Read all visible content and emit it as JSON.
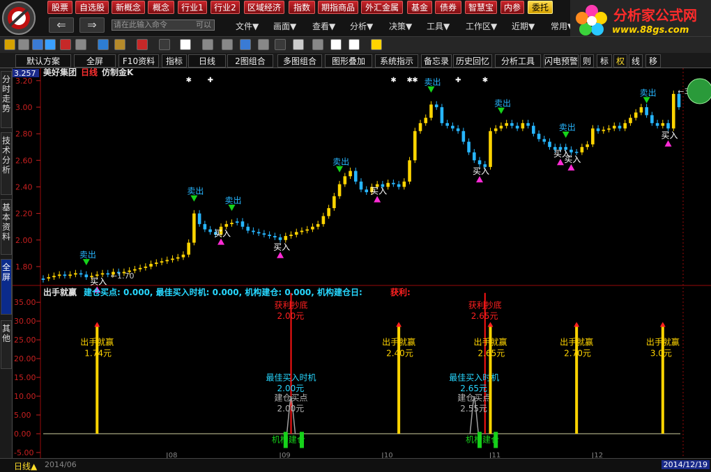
{
  "menu_buttons": [
    "股票",
    "自选股",
    "新概念",
    "概念",
    "行业1",
    "行业2",
    "区域经济",
    "指数",
    "期指商品",
    "外汇金属",
    "基金",
    "债券",
    "智慧宝",
    "内参",
    "委托"
  ],
  "command_input": {
    "placeholder": "请在此输入命令",
    "hint": "可以"
  },
  "nav": {
    "back": "⇐",
    "forward": "⇒"
  },
  "top_menus": [
    "文件▼",
    "画面▼",
    "查看▼",
    "分析▼",
    "决策▼",
    "工具▼",
    "工作区▼",
    "近期▼",
    "常用▼"
  ],
  "brand": {
    "title": "分析家公式网",
    "url": "www.88gs.com"
  },
  "tabs": [
    "默认方案",
    "全屏",
    "F10资料",
    "指标",
    "日线",
    "2图组合",
    "多图组合",
    "图形叠加",
    "系统指示",
    "备忘录",
    "历史回忆",
    "分析工具",
    "闪电预警",
    "则",
    "标",
    "权",
    "线",
    "移"
  ],
  "sidebar": [
    "分时走势",
    "技术分析",
    "基本资料",
    "全屏",
    "其他"
  ],
  "header": {
    "price_tag": "3.257",
    "stock_name": "美好集团",
    "period": "日线",
    "chart_style": "仿制金K"
  },
  "indicator_header": {
    "name": "出手就赢",
    "fields": "建仓买点: 0.000, 最佳买入时机: 0.000, 机构建仓: 0.000, 机构建仓日:",
    "profit": "获利:"
  },
  "colors": {
    "up": "#ffd400",
    "down": "#27b6ff",
    "buy": "#ff2bd6",
    "sell": "#16d21a",
    "profit": "#ff1414",
    "bg": "#000000",
    "axis": "#9a0a0a"
  },
  "chart_data": {
    "type": "candlestick",
    "price_ylim": [
      1.7,
      3.22
    ],
    "price_ticks": [
      "3.20",
      "3.00",
      "2.80",
      "2.60",
      "2.40",
      "2.20",
      "2.00",
      "1.80"
    ],
    "low_label": "1.70",
    "high_label": "3.1",
    "closes": [
      1.71,
      1.72,
      1.73,
      1.74,
      1.73,
      1.74,
      1.75,
      1.74,
      1.72,
      1.73,
      1.74,
      1.75,
      1.74,
      1.76,
      1.75,
      1.76,
      1.77,
      1.78,
      1.79,
      1.8,
      1.82,
      1.83,
      1.84,
      1.85,
      1.86,
      1.87,
      1.89,
      1.98,
      2.2,
      2.12,
      2.08,
      2.06,
      2.04,
      2.1,
      2.12,
      2.13,
      2.14,
      2.1,
      2.07,
      2.06,
      2.05,
      2.04,
      2.03,
      2.02,
      2.0,
      2.03,
      2.04,
      2.06,
      2.07,
      2.08,
      2.1,
      2.12,
      2.18,
      2.24,
      2.33,
      2.42,
      2.48,
      2.52,
      2.44,
      2.38,
      2.36,
      2.4,
      2.42,
      2.4,
      2.43,
      2.42,
      2.4,
      2.44,
      2.6,
      2.82,
      2.88,
      2.92,
      3.02,
      3.0,
      2.88,
      2.86,
      2.84,
      2.82,
      2.74,
      2.66,
      2.6,
      2.57,
      2.55,
      2.82,
      2.84,
      2.86,
      2.88,
      2.86,
      2.84,
      2.88,
      2.86,
      2.8,
      2.76,
      2.74,
      2.7,
      2.68,
      2.7,
      2.68,
      2.66,
      2.66,
      2.7,
      2.72,
      2.84,
      2.82,
      2.83,
      2.84,
      2.86,
      2.84,
      2.88,
      2.92,
      2.96,
      3.0,
      2.94,
      2.88,
      2.86,
      2.88,
      2.84,
      3.1,
      3.0
    ],
    "up_days": [
      1,
      2,
      3,
      5,
      6,
      9,
      10,
      11,
      13,
      15,
      16,
      17,
      18,
      19,
      20,
      21,
      22,
      23,
      24,
      25,
      26,
      27,
      28,
      33,
      34,
      35,
      45,
      46,
      47,
      48,
      49,
      50,
      51,
      52,
      53,
      54,
      55,
      56,
      57,
      61,
      62,
      64,
      67,
      68,
      69,
      70,
      71,
      72,
      83,
      84,
      85,
      86,
      89,
      100,
      101,
      102,
      104,
      105,
      106,
      108,
      109,
      110,
      111,
      115,
      117
    ],
    "sell_labels": [
      {
        "i": 8,
        "text": "卖出"
      },
      {
        "i": 28,
        "text": "卖出"
      },
      {
        "i": 35,
        "text": "卖出"
      },
      {
        "i": 55,
        "text": "卖出"
      },
      {
        "i": 72,
        "text": "卖出"
      },
      {
        "i": 85,
        "text": "卖出"
      },
      {
        "i": 97,
        "text": "卖出"
      },
      {
        "i": 112,
        "text": "卖出"
      }
    ],
    "buy_labels": [
      {
        "i": 10,
        "text": "买入"
      },
      {
        "i": 33,
        "text": "买入"
      },
      {
        "i": 44,
        "text": "买入"
      },
      {
        "i": 62,
        "text": "买入"
      },
      {
        "i": 81,
        "text": "买入"
      },
      {
        "i": 96,
        "text": "买入"
      },
      {
        "i": 98,
        "text": "买入"
      },
      {
        "i": 116,
        "text": "买入"
      }
    ],
    "star_marks": [
      {
        "i": 27,
        "m": "✱"
      },
      {
        "i": 31,
        "m": "✚"
      },
      {
        "i": 65,
        "m": "✱"
      },
      {
        "i": 68,
        "m": "✱"
      },
      {
        "i": 69,
        "m": "✱"
      },
      {
        "i": 77,
        "m": "✚"
      },
      {
        "i": 82,
        "m": "✱"
      }
    ],
    "ind_ylim": [
      -5,
      38
    ],
    "ind_ticks": [
      "35.00",
      "30.00",
      "25.00",
      "20.00",
      "15.00",
      "10.00",
      "5.00",
      "0.00",
      "-5.00"
    ],
    "signals": [
      {
        "i": 10,
        "name": "出手就赢",
        "price": "1.74元"
      },
      {
        "i": 66,
        "name": "出手就赢",
        "price": "2.40元"
      },
      {
        "i": 83,
        "name": "出手就赢",
        "price": "2.65元"
      },
      {
        "i": 99,
        "name": "出手就赢",
        "price": "2.70元"
      },
      {
        "i": 115,
        "name": "出手就赢",
        "price": "3.0元"
      }
    ],
    "profit_lines": [
      {
        "i": 46,
        "name": "获利抄底",
        "price": "2.00元"
      },
      {
        "i": 82,
        "name": "获利抄底",
        "price": "2.65元"
      }
    ],
    "best_buy": [
      {
        "i": 46,
        "name": "最佳买入时机",
        "price": "2.00元"
      },
      {
        "i": 80,
        "name": "最佳买入时机",
        "price": "2.65元"
      }
    ],
    "build_points": [
      {
        "i": 46,
        "name": "建仓买点",
        "price": "2.00元"
      },
      {
        "i": 80,
        "name": "建仓买点",
        "price": "2.55元"
      }
    ],
    "institution": [
      {
        "i": 45,
        "label": "机构建仓"
      },
      {
        "i": 81,
        "label": "机构建仓"
      }
    ],
    "date_labels": [
      {
        "i": 5,
        "text": "2014/06"
      },
      {
        "i": 23,
        "text": "08"
      },
      {
        "i": 44,
        "text": "09"
      },
      {
        "i": 63,
        "text": "10"
      },
      {
        "i": 83,
        "text": "11"
      },
      {
        "i": 102,
        "text": "12"
      }
    ],
    "end_date": "2014/12/19"
  },
  "bottom": {
    "period_button": "日线▲"
  }
}
